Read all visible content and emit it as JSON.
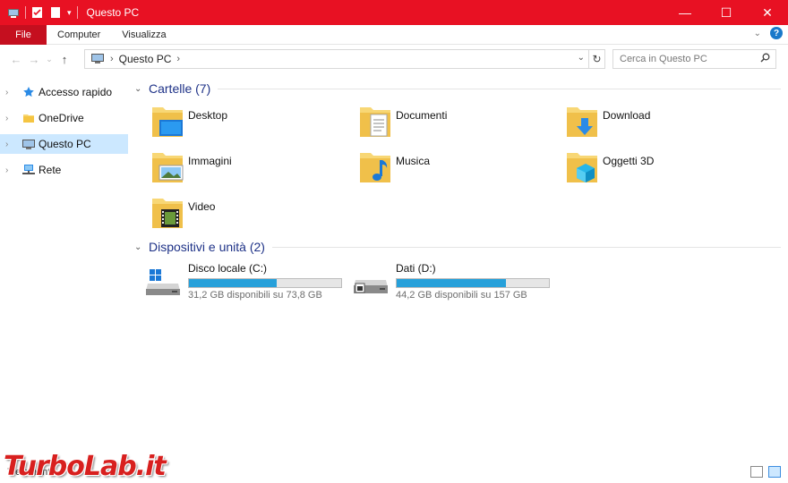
{
  "window": {
    "title": "Questo PC",
    "controls": {
      "minimize": "—",
      "maximize": "☐",
      "close": "✕"
    }
  },
  "ribbon": {
    "file_label": "File",
    "tabs": [
      "Computer",
      "Visualizza"
    ]
  },
  "navigation": {
    "back": "←",
    "forward": "→",
    "recent": "⌄",
    "up": "↑",
    "address_path": "Questo PC",
    "search_placeholder": "Cerca in Questo PC"
  },
  "sidebar": {
    "items": [
      {
        "label": "Accesso rapido",
        "icon": "star-pin-icon"
      },
      {
        "label": "OneDrive",
        "icon": "folder-icon"
      },
      {
        "label": "Questo PC",
        "icon": "computer-icon",
        "selected": true
      },
      {
        "label": "Rete",
        "icon": "network-icon"
      }
    ]
  },
  "main": {
    "folders_header": "Cartelle (7)",
    "folders": [
      {
        "name": "Desktop",
        "icon": "desktop-folder-icon"
      },
      {
        "name": "Documenti",
        "icon": "documents-folder-icon"
      },
      {
        "name": "Download",
        "icon": "download-folder-icon"
      },
      {
        "name": "Immagini",
        "icon": "pictures-folder-icon"
      },
      {
        "name": "Musica",
        "icon": "music-folder-icon"
      },
      {
        "name": "Oggetti 3D",
        "icon": "3d-objects-folder-icon"
      },
      {
        "name": "Video",
        "icon": "video-folder-icon"
      }
    ],
    "drives_header": "Dispositivi e unità (2)",
    "drives": [
      {
        "name": "Disco locale (C:)",
        "info": "31,2 GB disponibili su 73,8 GB",
        "used_fraction": 0.577,
        "icon": "windows-drive-icon"
      },
      {
        "name": "Dati (D:)",
        "info": "44,2 GB disponibili su 157 GB",
        "used_fraction": 0.718,
        "icon": "hard-drive-icon"
      }
    ]
  },
  "status": {
    "text": "7 elementi"
  },
  "watermark": "TurboLab.it",
  "colors": {
    "accent": "#e81123",
    "file_tab": "#c50f1f",
    "header_text": "#1e3287",
    "bar_fill": "#26a0da",
    "selection": "#cce8ff"
  }
}
